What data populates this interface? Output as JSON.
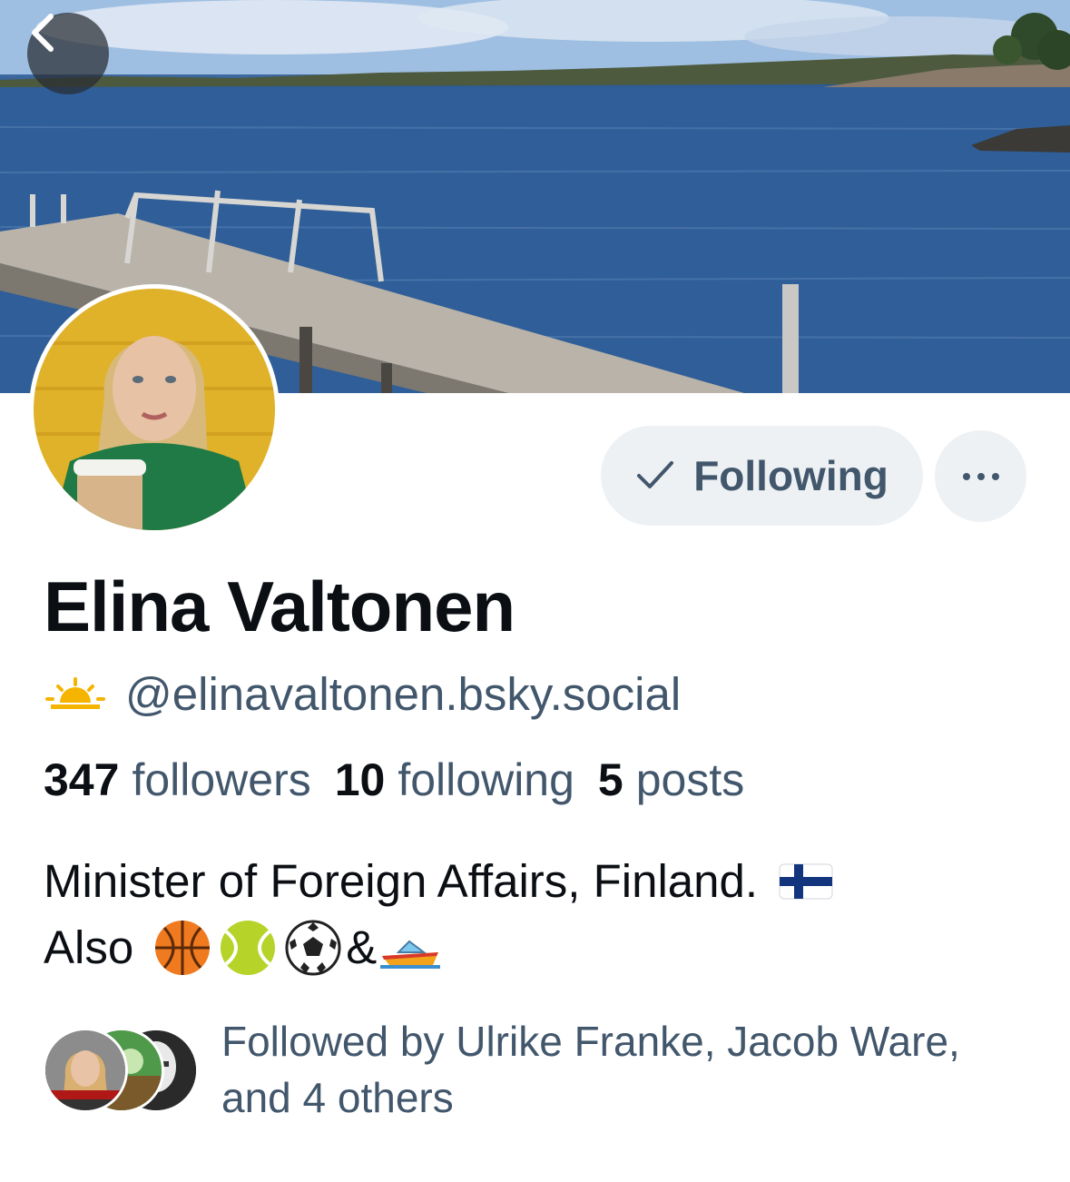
{
  "header": {
    "back_icon": "chevron-left-icon"
  },
  "profile": {
    "display_name": "Elina Valtonen",
    "handle": "@elinavaltonen.bsky.social",
    "handle_emoji": "sun-horizon-icon",
    "follow_button_label": "Following",
    "follow_icon": "checkmark-icon",
    "more_icon": "ellipsis-icon",
    "stats": {
      "followers_count": "347",
      "followers_label": "followers",
      "following_count": "10",
      "following_label": "following",
      "posts_count": "5",
      "posts_label": "posts"
    },
    "bio": {
      "line1": "Minister of Foreign Affairs, Finland.",
      "line2_text": "Also",
      "line2_amp": "&"
    },
    "followed_by": "Followed by Ulrike Franke, Jacob Ware, and 4 others"
  },
  "colors": {
    "text_primary": "#0b0f14",
    "text_secondary": "#42576c",
    "button_bg": "#eef1f4"
  }
}
